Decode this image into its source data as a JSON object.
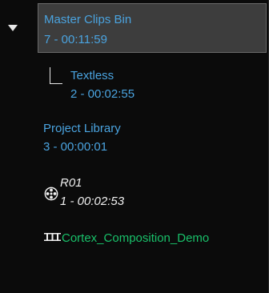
{
  "tree": {
    "selected_bin": {
      "name": "Master Clips Bin",
      "info": "7 - 00:11:59"
    },
    "child_bin": {
      "name": "Textless",
      "info": "2 - 00:02:55"
    },
    "library": {
      "name": "Project Library",
      "info": "3 - 00:00:01"
    },
    "reel": {
      "name": "R01",
      "info": "1 - 00:02:53",
      "icon": "film-reel-icon"
    },
    "composition": {
      "name": "Cortex_Composition_Demo",
      "icon": "sequence-icon"
    }
  },
  "colors": {
    "background": "#0b0b0b",
    "selected_bg": "#3d3d3d",
    "bin_text": "#4aa3df",
    "reel_text": "#f0f0f0",
    "composition_text": "#19c16a"
  }
}
